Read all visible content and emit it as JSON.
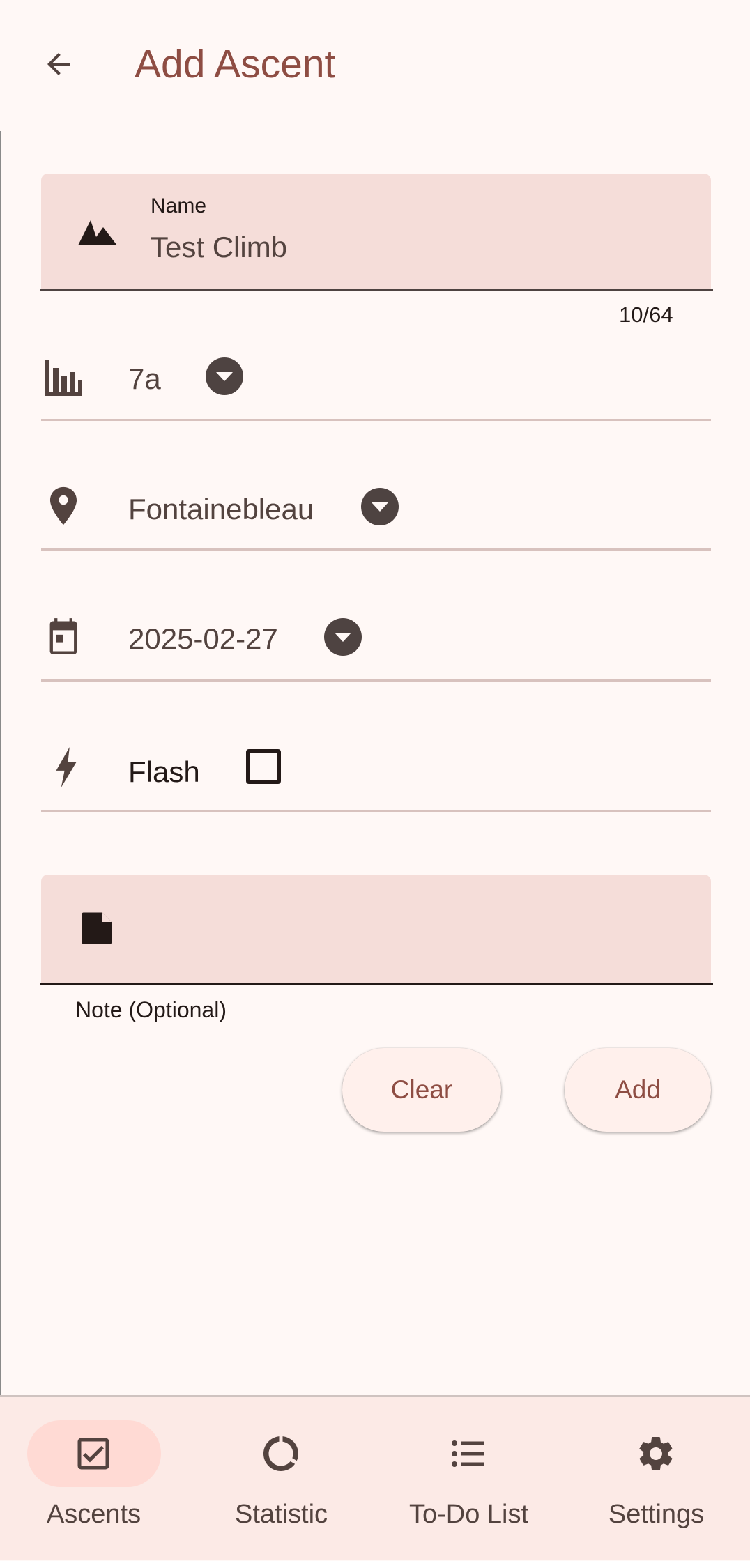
{
  "app_bar": {
    "title": "Add Ascent",
    "back_icon": "arrow-back-icon"
  },
  "form": {
    "name": {
      "label": "Name",
      "value": "Test Climb",
      "counter": "10/64",
      "icon": "terrain-icon"
    },
    "grade": {
      "value": "7a",
      "icon": "bar-chart-icon"
    },
    "location": {
      "value": "Fontainebleau",
      "icon": "location-pin-icon"
    },
    "date": {
      "value": "2025-02-27",
      "icon": "calendar-icon"
    },
    "flash": {
      "label": "Flash",
      "checked": false,
      "icon": "flash-icon"
    },
    "note": {
      "label": "Note (Optional)",
      "value": "",
      "icon": "note-icon"
    }
  },
  "buttons": {
    "clear": "Clear",
    "add": "Add"
  },
  "bottom_nav": {
    "active": "Ascents",
    "items": [
      {
        "label": "Ascents",
        "icon": "check-box-icon"
      },
      {
        "label": "Statistic",
        "icon": "donut-chart-icon"
      },
      {
        "label": "To-Do List",
        "icon": "list-icon"
      },
      {
        "label": "Settings",
        "icon": "gear-icon"
      }
    ]
  },
  "colors": {
    "accent": "#8e4d43",
    "surface": "#fff8f6",
    "field": "#f5ddd9",
    "nav_bg": "#fceae6",
    "active_pill": "#ffdad4"
  }
}
